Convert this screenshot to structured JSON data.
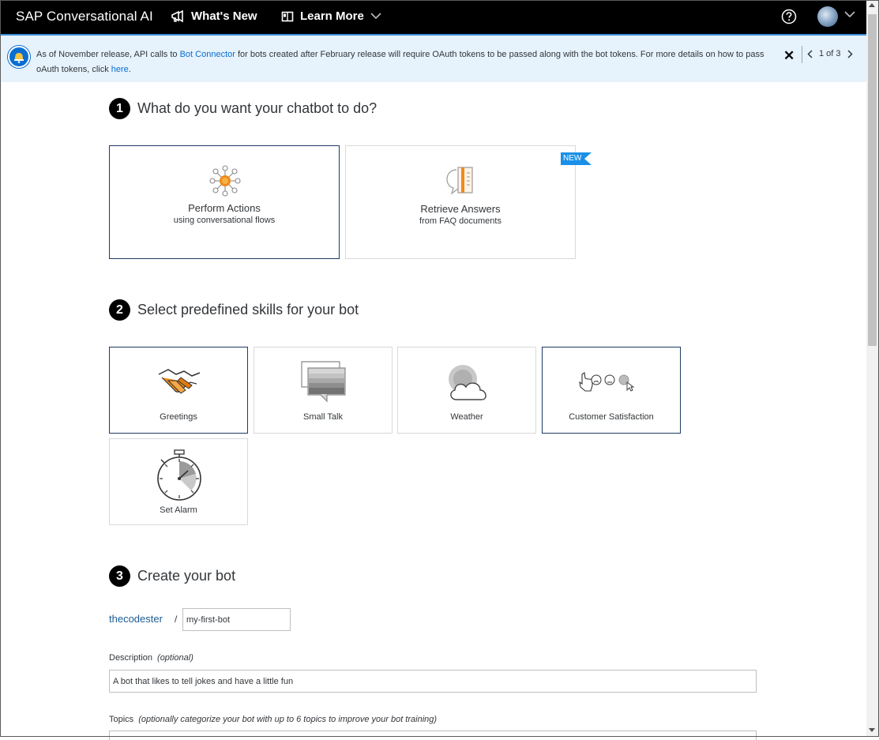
{
  "header": {
    "brand": "SAP Conversational AI",
    "whats_new": "What's New",
    "learn_more": "Learn More"
  },
  "banner": {
    "text_part1": "As of November release, API calls to ",
    "link1": "Bot Connector",
    "text_part2": " for bots created after February release will require OAuth tokens to be passed along with the bot tokens. For more details on how to pass oAuth tokens, click ",
    "link2": "here",
    "text_part3": ".",
    "pager": "1 of 3"
  },
  "step1": {
    "number": "1",
    "title": "What do you want your chatbot to do?",
    "cards": [
      {
        "title": "Perform Actions",
        "subtitle": "using conversational flows"
      },
      {
        "title": "Retrieve Answers",
        "subtitle": "from FAQ documents",
        "badge": "NEW"
      }
    ]
  },
  "step2": {
    "number": "2",
    "title": "Select predefined skills for your bot",
    "skills": [
      {
        "label": "Greetings"
      },
      {
        "label": "Small Talk"
      },
      {
        "label": "Weather"
      },
      {
        "label": "Customer Satisfaction"
      },
      {
        "label": "Set Alarm"
      }
    ]
  },
  "step3": {
    "number": "3",
    "title": "Create your bot",
    "owner": "thecodester",
    "separator": "/",
    "bot_name": "my-first-bot",
    "description_label": "Description",
    "description_hint": "(optional)",
    "description_value": "A bot that likes to tell jokes and have a little fun",
    "topics_label": "Topics",
    "topics_hint": "(optionally categorize your bot with up to 6 topics to improve your bot training)"
  },
  "colors": {
    "accent": "#0a6ed1",
    "selected_border": "#1d3b63",
    "badge": "#1b90e8",
    "orange": "#f08a1c"
  }
}
